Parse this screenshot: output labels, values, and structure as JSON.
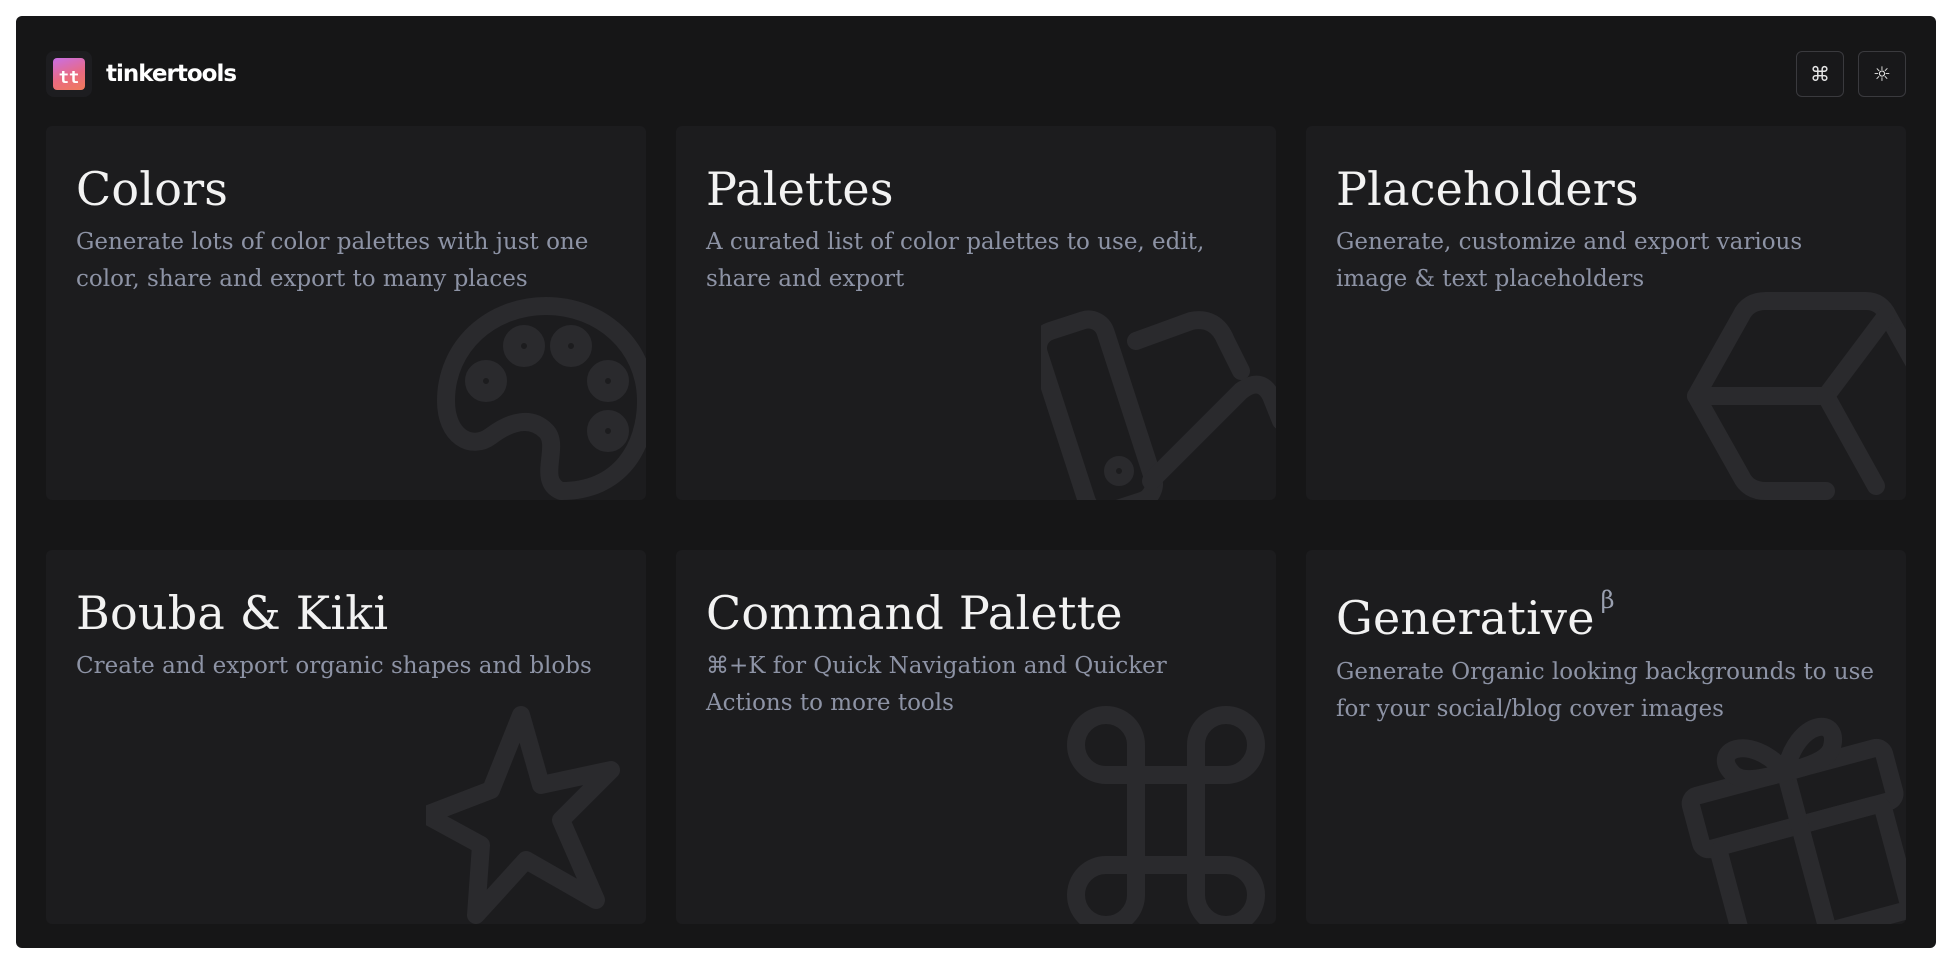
{
  "header": {
    "logo_text": "tt",
    "brand_name": "tinkertools",
    "command_icon": "⌘",
    "theme_icon": "☼"
  },
  "cards": [
    {
      "title": "Colors",
      "description": "Generate lots of color palettes with just one color, share and export to many places",
      "icon": "palette-icon"
    },
    {
      "title": "Palettes",
      "description": "A curated list of color palettes to use, edit, share and export",
      "icon": "swatches-icon"
    },
    {
      "title": "Placeholders",
      "description": "Generate, customize and export various image & text placeholders",
      "icon": "cube-icon"
    },
    {
      "title": "Bouba & Kiki",
      "description": "Create and export organic shapes and blobs",
      "icon": "star-icon"
    },
    {
      "title": "Command Palette",
      "description": "⌘+K for Quick Navigation and Quicker Actions to more tools",
      "icon": "command-icon"
    },
    {
      "title": "Generative",
      "badge": "β",
      "description": "Generate Organic looking backgrounds to use for your social/blog cover images",
      "icon": "gift-icon"
    }
  ]
}
